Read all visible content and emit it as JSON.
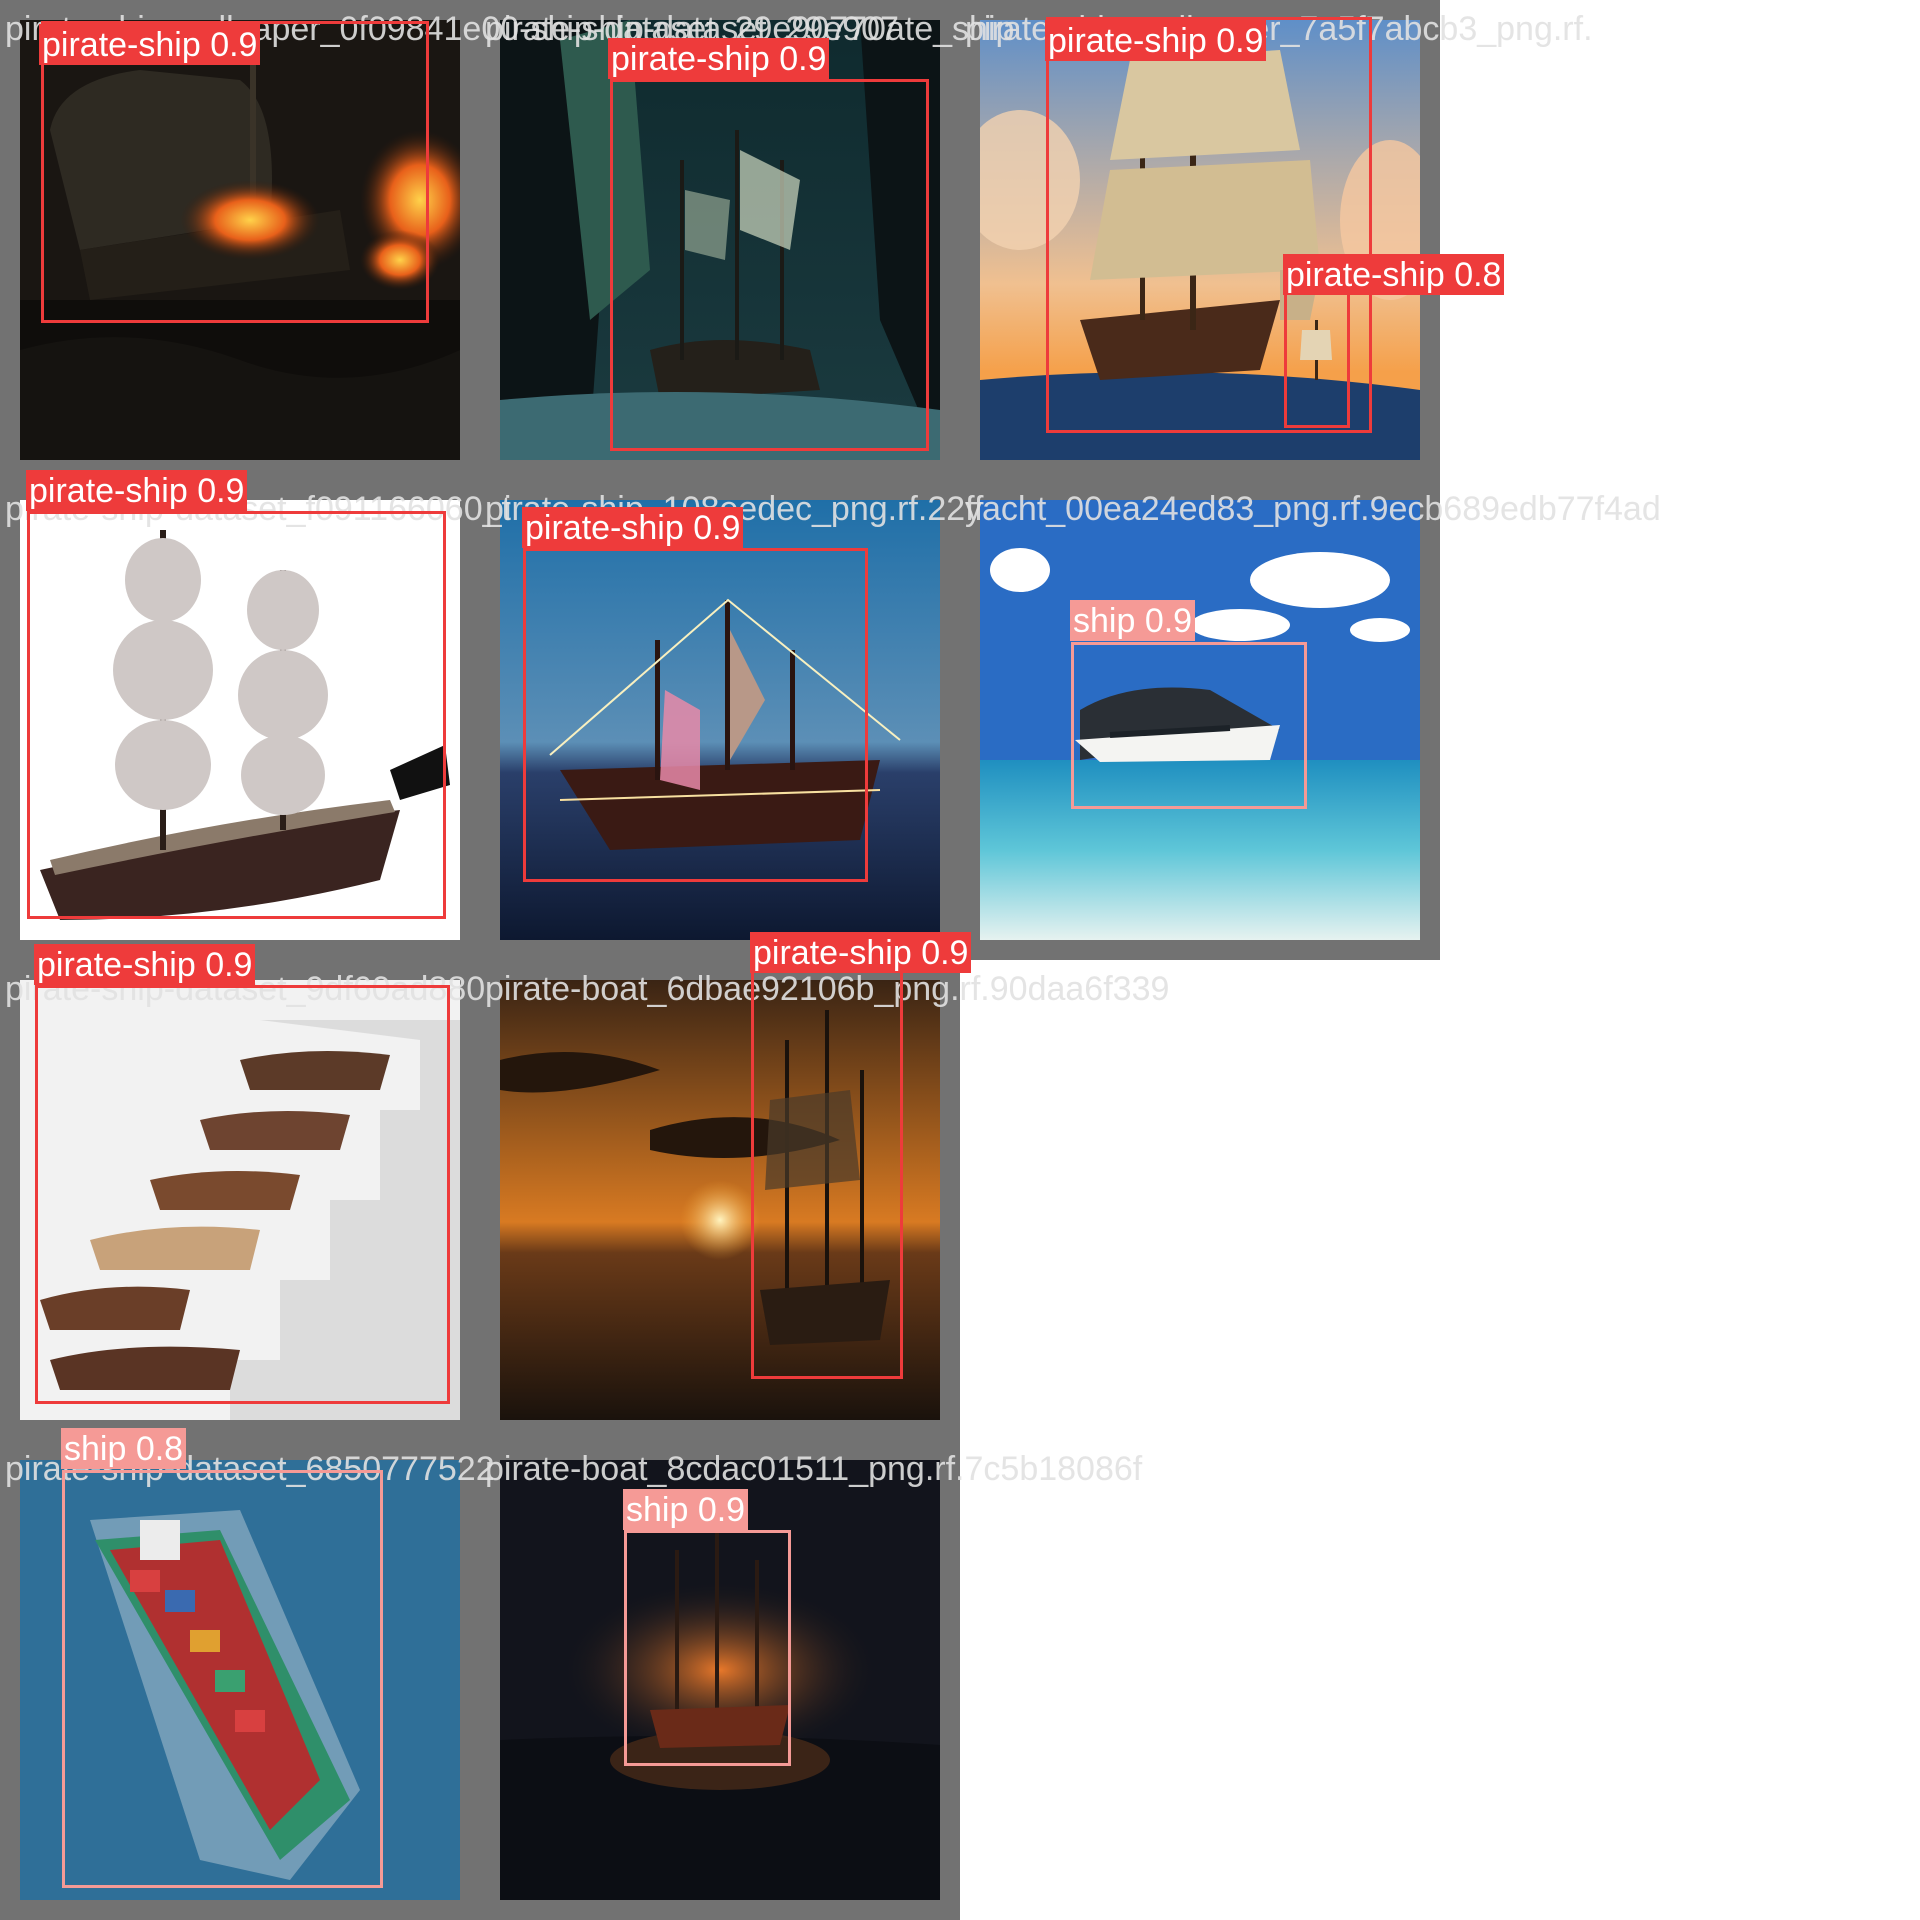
{
  "colors": {
    "pirate_ship": "#ee3b3b",
    "ship": "#f59a96",
    "tile_border": "#727272"
  },
  "tiles": [
    {
      "filename": "pirate-ship-wallpaper_0f09841e00-ship-dataset_29e90770ate_ship",
      "detections": [
        {
          "label": "pirate-ship 0.9",
          "class": "pirate-ship",
          "confidence": 0.9
        }
      ]
    },
    {
      "filename": "pirate-ship-dataset_29e907",
      "detections": [
        {
          "label": "pirate-ship 0.9",
          "class": "pirate-ship",
          "confidence": 0.9
        }
      ]
    },
    {
      "filename": "pirate-ship-wallpaper_7a5f7abcb3_png.rf.",
      "detections": [
        {
          "label": "pirate-ship 0.9",
          "class": "pirate-ship",
          "confidence": 0.9
        },
        {
          "label": "pirate-ship 0.8",
          "class": "pirate-ship",
          "confidence": 0.8
        }
      ]
    },
    {
      "filename": "pirate-ship-dataset_f091166060_t",
      "detections": [
        {
          "label": "pirate-ship 0.9",
          "class": "pirate-ship",
          "confidence": 0.9
        }
      ]
    },
    {
      "filename": "pirate-ship_108eedec_png.rf.22ff",
      "detections": [
        {
          "label": "pirate-ship 0.9",
          "class": "pirate-ship",
          "confidence": 0.9
        }
      ]
    },
    {
      "filename": "yacht_00ea24ed83_png.rf.9ecb689edb77f4ad",
      "detections": [
        {
          "label": "ship 0.9",
          "class": "ship",
          "confidence": 0.9
        }
      ]
    },
    {
      "filename": "pirate-ship-dataset_9df60ad880",
      "detections": [
        {
          "label": "pirate-ship 0.9",
          "class": "pirate-ship",
          "confidence": 0.9
        }
      ]
    },
    {
      "filename": "pirate-boat_6dbae92106b_png.rf.90daa6f339",
      "detections": [
        {
          "label": "pirate-ship 0.9",
          "class": "pirate-ship",
          "confidence": 0.9
        }
      ]
    },
    {
      "filename": "pirate-ship-dataset_6850777522",
      "detections": [
        {
          "label": "ship 0.8",
          "class": "ship",
          "confidence": 0.8
        }
      ]
    },
    {
      "filename": "pirate-boat_8cdac01511_png.rf.7c5b18086f",
      "detections": [
        {
          "label": "ship 0.9",
          "class": "ship",
          "confidence": 0.9
        }
      ]
    }
  ]
}
